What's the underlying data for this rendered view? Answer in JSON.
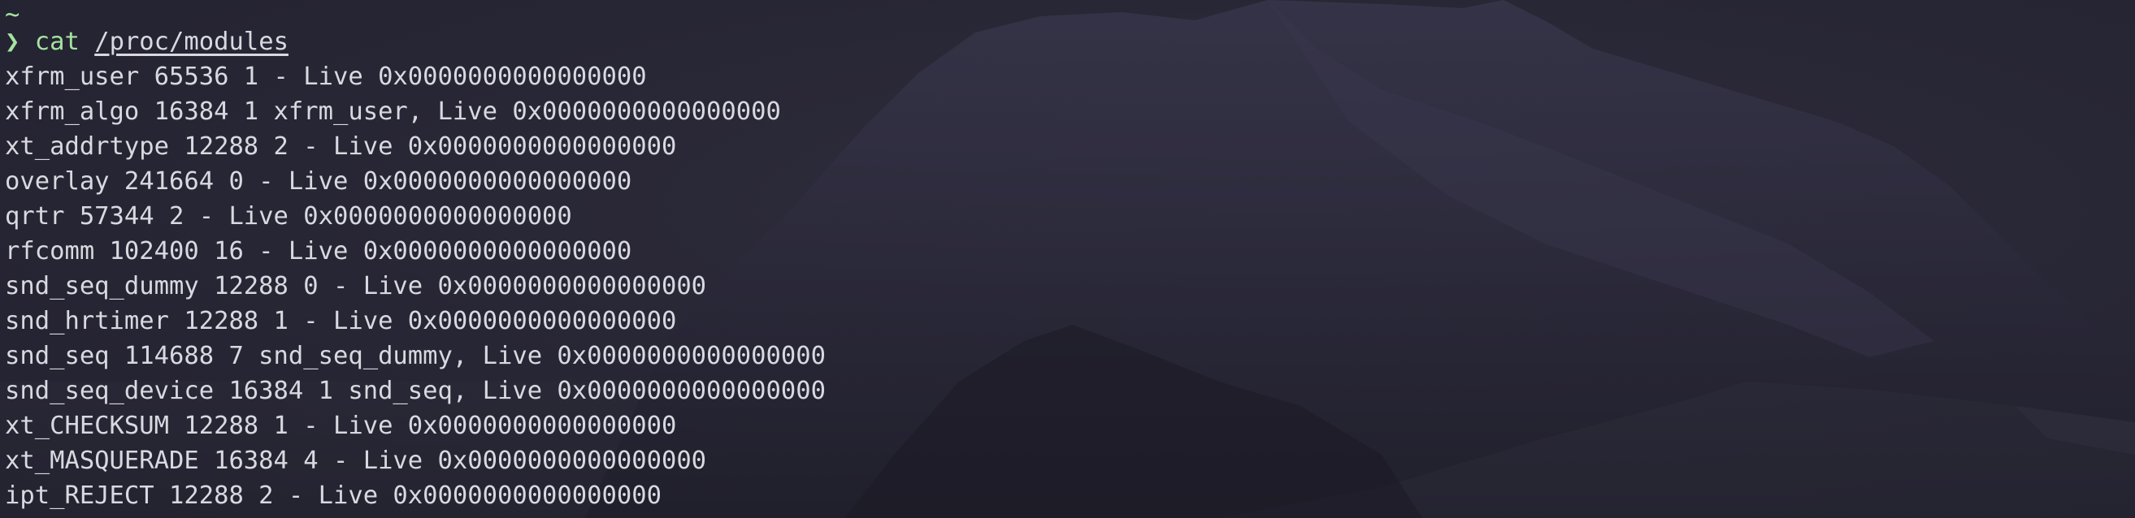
{
  "terminal": {
    "cwd": "~",
    "prompt_symbol": "❯",
    "command": "cat",
    "argument": "/proc/modules",
    "output": [
      "xfrm_user 65536 1 - Live 0x0000000000000000",
      "xfrm_algo 16384 1 xfrm_user, Live 0x0000000000000000",
      "xt_addrtype 12288 2 - Live 0x0000000000000000",
      "overlay 241664 0 - Live 0x0000000000000000",
      "qrtr 57344 2 - Live 0x0000000000000000",
      "rfcomm 102400 16 - Live 0x0000000000000000",
      "snd_seq_dummy 12288 0 - Live 0x0000000000000000",
      "snd_hrtimer 12288 1 - Live 0x0000000000000000",
      "snd_seq 114688 7 snd_seq_dummy, Live 0x0000000000000000",
      "snd_seq_device 16384 1 snd_seq, Live 0x0000000000000000",
      "xt_CHECKSUM 12288 1 - Live 0x0000000000000000",
      "xt_MASQUERADE 16384 4 - Live 0x0000000000000000",
      "ipt_REJECT 12288 2 - Live 0x0000000000000000"
    ]
  },
  "colors": {
    "background": "#2a2938",
    "prompt": "#a6e3a1",
    "text": "#d8d9e0"
  }
}
